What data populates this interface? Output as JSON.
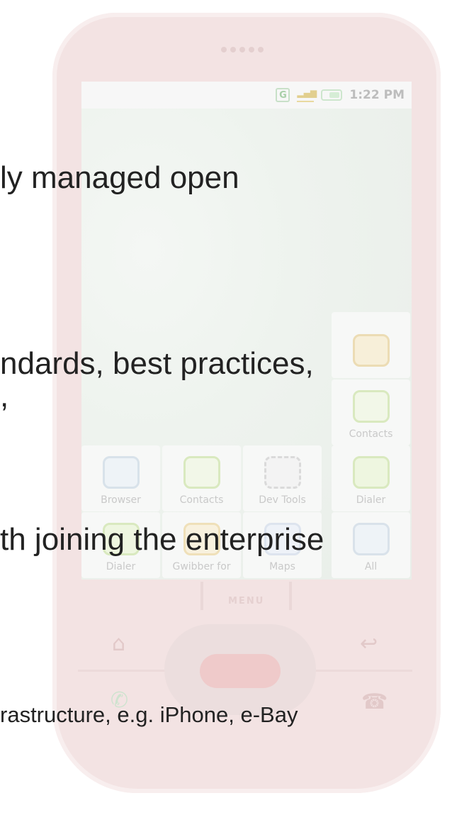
{
  "statusbar": {
    "g_indicator": "G",
    "time": "1:22 PM"
  },
  "menu_label": "MENU",
  "right_column": [
    {
      "label": "",
      "icon": "certificate-icon"
    },
    {
      "label": "Contacts",
      "icon": "contacts-icon"
    },
    {
      "label": "Dialer",
      "icon": "dialer-icon"
    },
    {
      "label": "All",
      "icon": "all-apps-icon"
    }
  ],
  "grid_row1": [
    {
      "label": "Browser",
      "icon": "browser-icon"
    },
    {
      "label": "Contacts",
      "icon": "contacts-icon"
    },
    {
      "label": "Dev Tools",
      "icon": "gear-icon"
    }
  ],
  "grid_row2": [
    {
      "label": "Dialer",
      "icon": "dialer-icon"
    },
    {
      "label": "Gwibber for",
      "icon": "gwibber-icon"
    },
    {
      "label": "Maps",
      "icon": "maps-icon"
    }
  ],
  "slide": {
    "line1": "ly managed open",
    "line2": "ndards, best practices,",
    "line2b": ",",
    "line3": "th joining the enterprise",
    "line4": "rastructure, e.g. iPhone, e-Bay"
  }
}
